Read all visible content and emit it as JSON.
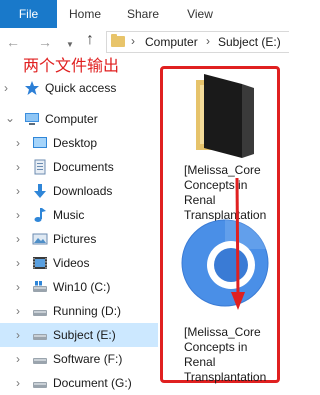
{
  "ribbon": {
    "tabs": [
      {
        "label": "File"
      },
      {
        "label": "Home"
      },
      {
        "label": "Share"
      },
      {
        "label": "View"
      }
    ]
  },
  "address": {
    "crumbs": [
      {
        "label": "Computer"
      },
      {
        "label": "Subject (E:)"
      }
    ]
  },
  "annotation": {
    "text": "两个文件输出",
    "color": "#e02020"
  },
  "sidebar": {
    "items": [
      {
        "label": "Quick access",
        "icon": "star-icon"
      },
      {
        "label": "Computer",
        "icon": "computer-icon"
      },
      {
        "label": "Desktop",
        "icon": "desktop-icon"
      },
      {
        "label": "Documents",
        "icon": "documents-icon"
      },
      {
        "label": "Downloads",
        "icon": "download-icon"
      },
      {
        "label": "Music",
        "icon": "music-icon"
      },
      {
        "label": "Pictures",
        "icon": "pictures-icon"
      },
      {
        "label": "Videos",
        "icon": "videos-icon"
      },
      {
        "label": "Win10 (C:)",
        "icon": "drive-icon"
      },
      {
        "label": "Running (D:)",
        "icon": "drive-icon"
      },
      {
        "label": "Subject (E:)",
        "icon": "drive-icon",
        "selected": true
      },
      {
        "label": "Software (F:)",
        "icon": "drive-icon"
      },
      {
        "label": "Document (G:)",
        "icon": "drive-icon"
      }
    ]
  },
  "files": [
    {
      "name_lines": [
        "[Melissa_Core",
        "Concepts in",
        "Renal",
        "Transplantation"
      ],
      "icon": "folder-icon"
    },
    {
      "name_lines": [
        "[Melissa_Core",
        "Concepts in",
        "Renal",
        "Transplantation"
      ],
      "icon": "chrome-html-icon"
    }
  ],
  "colors": {
    "accent": "#1979ca",
    "selection": "#cce8ff",
    "annotation_red": "#e02020"
  }
}
